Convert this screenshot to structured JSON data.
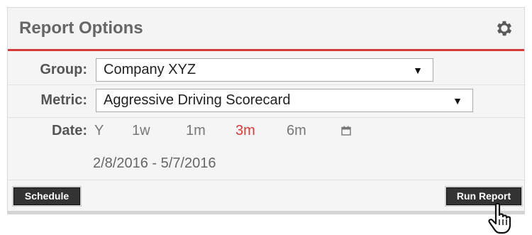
{
  "panel": {
    "title": "Report Options",
    "settings_icon": "gear-icon"
  },
  "group": {
    "label": "Group:",
    "value": "Company XYZ"
  },
  "metric": {
    "label": "Metric:",
    "value": "Aggressive Driving Scorecard"
  },
  "date": {
    "label": "Date:",
    "options": [
      "Y",
      "1w",
      "1m",
      "3m",
      "6m"
    ],
    "selected": "3m",
    "calendar_icon": "calendar-icon",
    "range": "2/8/2016 - 5/7/2016"
  },
  "buttons": {
    "schedule": "Schedule",
    "run_report": "Run Report"
  },
  "colors": {
    "accent": "#d63a3a",
    "button_bg": "#333333"
  }
}
